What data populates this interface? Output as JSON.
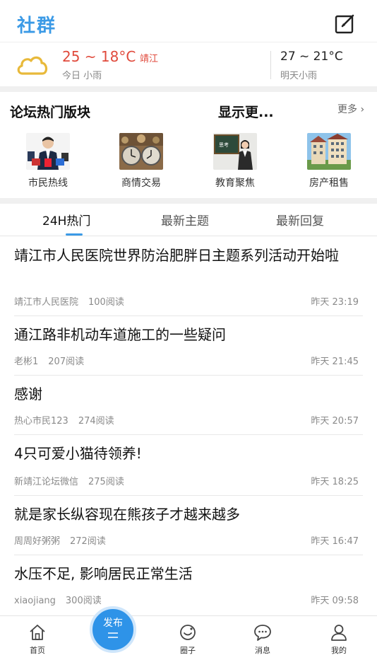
{
  "header": {
    "title": "社群",
    "compose_icon": "compose-icon"
  },
  "weather": {
    "today_temp": "25 ~ 18°C",
    "city": "靖江",
    "today_desc": "今日 小雨",
    "tomorrow_temp": "27 ~ 21°C",
    "tomorrow_desc": "明天小雨",
    "icon": "cloud-icon",
    "colors": {
      "today": "#e04a3c"
    }
  },
  "forums": {
    "title": "论坛热门版块",
    "mid_text": "显示更...",
    "more_label": "更多 ›",
    "items": [
      {
        "label": "市民热线",
        "icon": "news-anchor-image"
      },
      {
        "label": "商情交易",
        "icon": "clocks-image"
      },
      {
        "label": "教育聚焦",
        "icon": "teacher-image"
      },
      {
        "label": "房产租售",
        "icon": "buildings-image"
      }
    ]
  },
  "tabs": {
    "items": [
      "24H热门",
      "最新主题",
      "最新回复"
    ],
    "active": "24H热门",
    "accent": "#3b9ae6"
  },
  "posts": [
    {
      "title": "靖江市人民医院世界防治肥胖日主题系列活动开始啦",
      "author": "靖江市人民医院",
      "reads": "100阅读",
      "time": "昨天 23:19"
    },
    {
      "title": "通江路非机动车道施工的一些疑问",
      "author": "老彬1",
      "reads": "207阅读",
      "time": "昨天 21:45"
    },
    {
      "title": "感谢",
      "author": "热心市民123",
      "reads": "274阅读",
      "time": "昨天 20:57"
    },
    {
      "title": "4只可爱小猫待领养!",
      "author": "新靖江论坛微信",
      "reads": "275阅读",
      "time": "昨天 18:25"
    },
    {
      "title": "就是家长纵容现在熊孩子才越来越多",
      "author": "周周好粥粥",
      "reads": "272阅读",
      "time": "昨天 16:47"
    },
    {
      "title": "水压不足, 影响居民正常生活",
      "author": "xiaojiang",
      "reads": "300阅读",
      "time": "昨天 09:58"
    }
  ],
  "tabbar": {
    "publish_label": "发布",
    "items": [
      {
        "label": "首页",
        "icon": "home-icon"
      },
      {
        "label": "圈子",
        "icon": "circle-icon"
      },
      {
        "label": "消息",
        "icon": "message-icon"
      },
      {
        "label": "我的",
        "icon": "profile-icon"
      }
    ],
    "publish_color": "#2e93e8"
  }
}
